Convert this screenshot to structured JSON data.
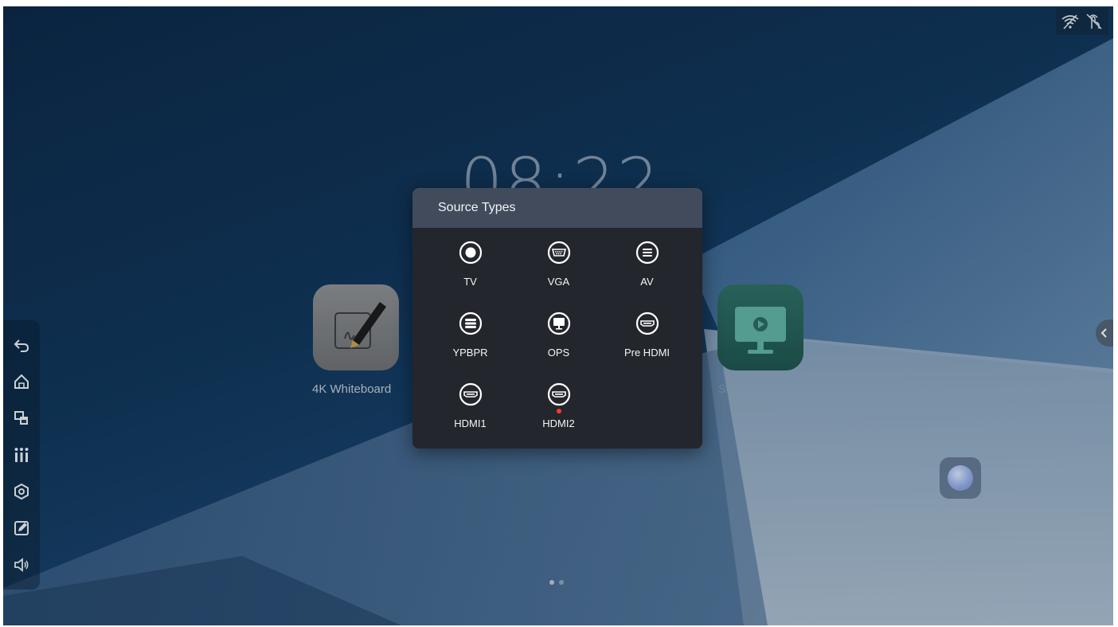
{
  "status_bar": {
    "icons": [
      "wifi-off-icon",
      "touch-off-icon"
    ]
  },
  "clock": {
    "time": "08:22"
  },
  "apps": [
    {
      "name": "4K Whiteboard",
      "icon": "pen-drawing-icon",
      "color": "#7d8083"
    },
    {
      "name": "Screen Share",
      "icon": "monitor-cast-icon",
      "color": "#2a6a62"
    }
  ],
  "left_dock": {
    "items": [
      "back-icon",
      "home-icon",
      "multi-window-icon",
      "equalizer-icon",
      "settings-icon",
      "annotate-icon",
      "volume-icon"
    ]
  },
  "source_dialog": {
    "title": "Source Types",
    "sources": [
      {
        "label": "TV",
        "icon": "tv-source-icon",
        "has_signal": false
      },
      {
        "label": "VGA",
        "icon": "vga-port-icon",
        "has_signal": false
      },
      {
        "label": "AV",
        "icon": "av-port-icon",
        "has_signal": false
      },
      {
        "label": "YPBPR",
        "icon": "ypbpr-port-icon",
        "has_signal": false
      },
      {
        "label": "OPS",
        "icon": "ops-monitor-icon",
        "has_signal": false
      },
      {
        "label": "Pre HDMI",
        "icon": "hdmi-port-icon",
        "has_signal": false
      },
      {
        "label": "HDMI1",
        "icon": "hdmi-port-icon",
        "has_signal": false
      },
      {
        "label": "HDMI2",
        "icon": "hdmi-port-icon",
        "has_signal": true
      }
    ]
  },
  "page_indicator": {
    "pages": 2,
    "current": 1
  },
  "colors": {
    "dialog_bg": "#23262d",
    "dialog_header": "#414b5c",
    "signal": "#ff3b30"
  }
}
